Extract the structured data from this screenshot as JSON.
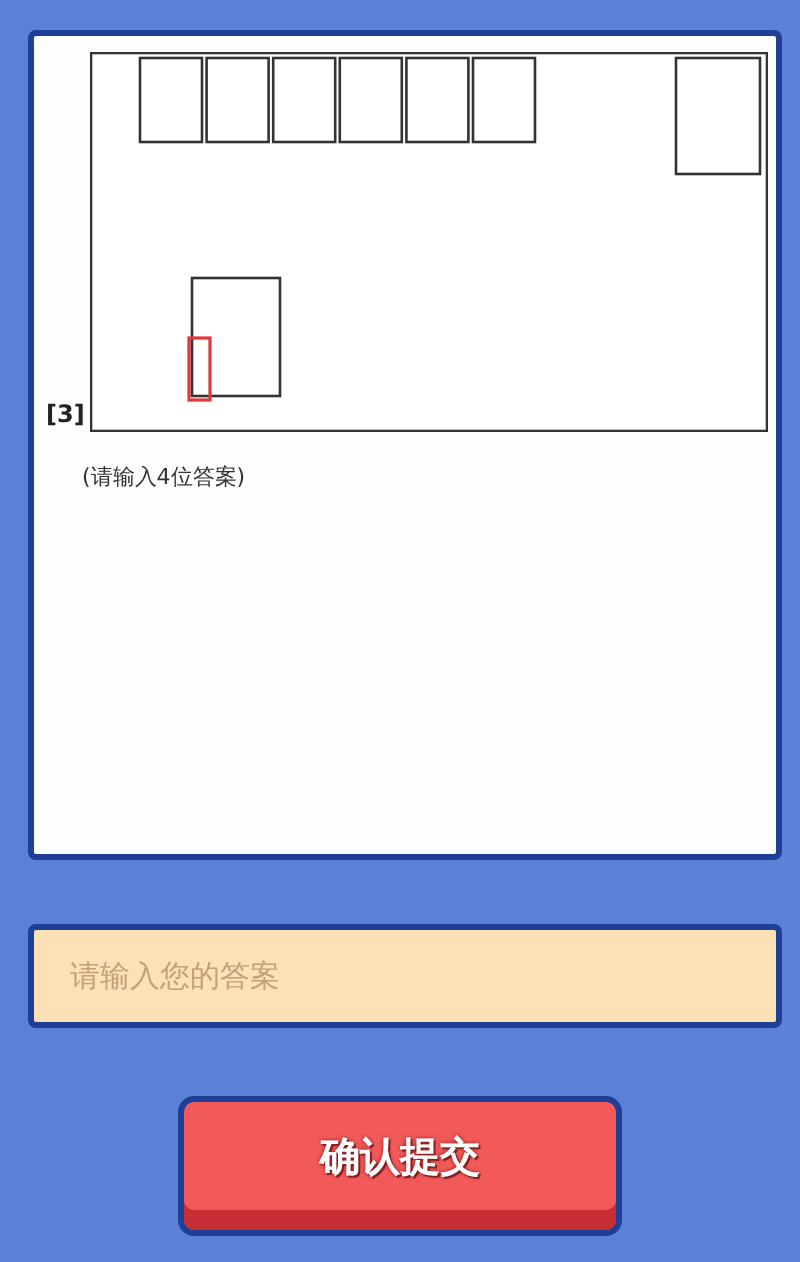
{
  "question": {
    "number": "[3]",
    "hint": "(请输入4位答案)"
  },
  "answer_field": {
    "placeholder": "请输入您的答案"
  },
  "submit_button": {
    "label": "确认提交"
  }
}
